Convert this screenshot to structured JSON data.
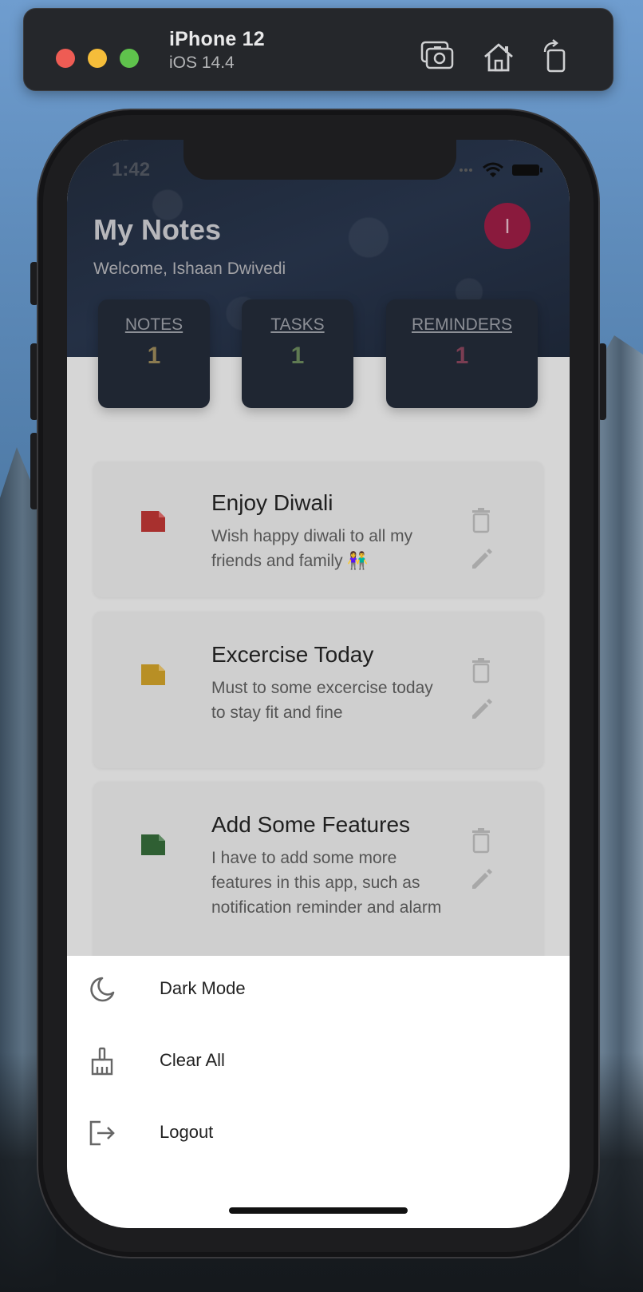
{
  "simulator": {
    "device_name": "iPhone 12",
    "os_version": "iOS 14.4",
    "buttons": {
      "screenshot": "camera-icon",
      "home": "home-icon",
      "rotate": "rotate-icon"
    }
  },
  "status_bar": {
    "time": "1:42"
  },
  "header": {
    "title": "My Notes",
    "welcome": "Welcome, Ishaan Dwivedi",
    "avatar_letter": "I"
  },
  "stats": [
    {
      "label": "NOTES",
      "count": "1",
      "color": "#8a7a50"
    },
    {
      "label": "TASKS",
      "count": "1",
      "color": "#5f7a52"
    },
    {
      "label": "REMINDERS",
      "count": "1",
      "color": "#7a3d52"
    }
  ],
  "notes": [
    {
      "title": "Enjoy Diwali",
      "body": "Wish happy diwali to all my friends and family 👫",
      "color": "#a8302e"
    },
    {
      "title": "Excercise Today",
      "body": "Must to some excercise today to stay fit and fine",
      "color": "#b88f25"
    },
    {
      "title": "Add Some Features",
      "body": "I have to add some more features in this app, such as notification reminder and alarm",
      "color": "#2f5f33"
    }
  ],
  "menu": [
    {
      "label": "Dark Mode",
      "icon": "moon-icon"
    },
    {
      "label": "Clear All",
      "icon": "broom-icon"
    },
    {
      "label": "Logout",
      "icon": "logout-icon"
    }
  ]
}
